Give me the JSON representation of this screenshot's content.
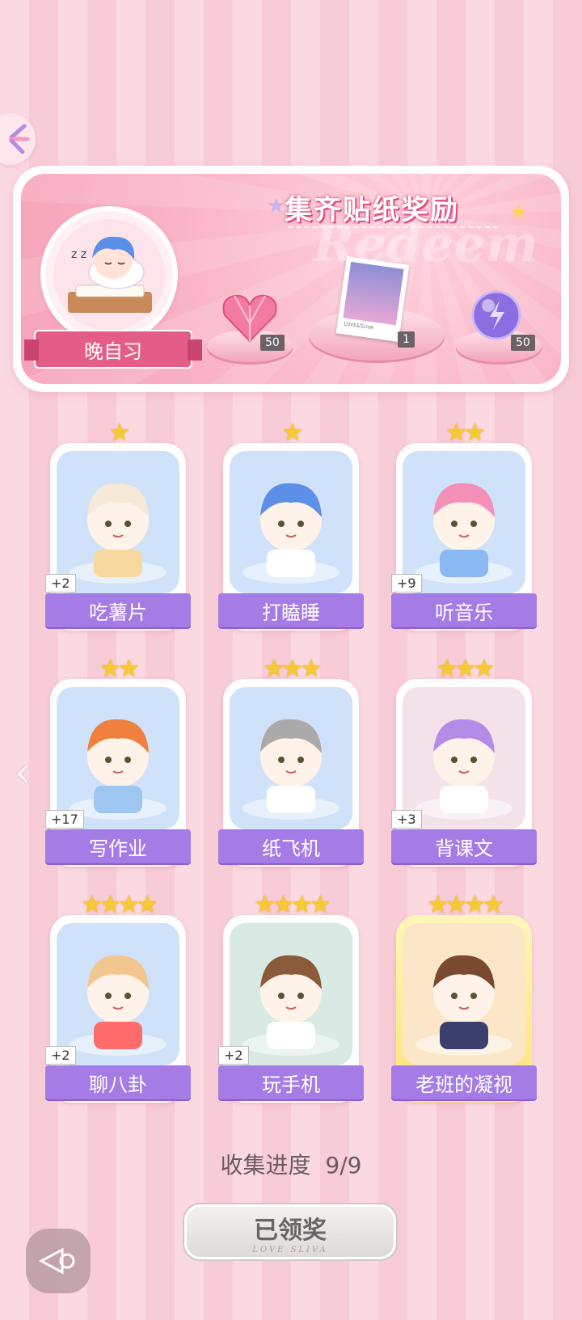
{
  "banner": {
    "title": "集齐贴纸奖励",
    "watermark": "Redeem",
    "avatar_label": "晚自习",
    "rewards": [
      {
        "icon": "heart-gem-icon",
        "count": "50"
      },
      {
        "icon": "photo-card-icon",
        "count": "1"
      },
      {
        "icon": "energy-orb-icon",
        "count": "50"
      }
    ],
    "photo_caption": "LOVE&SLIVA"
  },
  "cards": [
    {
      "label": "吃薯片",
      "stars": "★",
      "plus": "+2",
      "scene": "cat-eating-chips"
    },
    {
      "label": "打瞌睡",
      "stars": "★",
      "plus": "",
      "scene": "boy-sleeping-desk"
    },
    {
      "label": "听音乐",
      "stars": "★★",
      "plus": "+9",
      "scene": "girl-headphones"
    },
    {
      "label": "写作业",
      "stars": "★★",
      "plus": "+17",
      "scene": "boy-homework"
    },
    {
      "label": "纸飞机",
      "stars": "★★★",
      "plus": "",
      "scene": "cat-paper-plane"
    },
    {
      "label": "背课文",
      "stars": "★★★",
      "plus": "+3",
      "scene": "girl-classroom"
    },
    {
      "label": "聊八卦",
      "stars": "★★★★",
      "plus": "+2",
      "scene": "dog-watermelon"
    },
    {
      "label": "玩手机",
      "stars": "★★★★",
      "plus": "+2",
      "scene": "girl-phone"
    },
    {
      "label": "老班的凝视",
      "stars": "★★★★",
      "plus": "",
      "scene": "teacher-glasses"
    }
  ],
  "progress": {
    "label": "收集进度",
    "value": "9/9"
  },
  "claim": {
    "label": "已领奖",
    "sub": "LOVE SLIVA"
  },
  "colors": {
    "accent": "#a57ce6",
    "pink": "#e45d86",
    "star": "#f7c933"
  }
}
